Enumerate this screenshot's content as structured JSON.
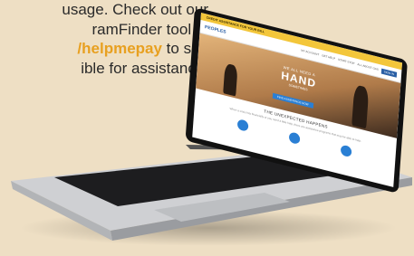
{
  "promo": {
    "line1": "usage. Check out our",
    "line2": "ramFinder tool at",
    "line3": "/helpmepay",
    "line3_suffix": " to see",
    "line4": "ible for assistance."
  },
  "screen": {
    "banner": "CREDIT ASSISTANCE FOR YOUR BILL",
    "logo": "PEOPLES",
    "nav": [
      "MY ACCOUNT",
      "GET HELP",
      "START STOP",
      "ALL ABOUT GAS"
    ],
    "nav_cta": "SIGN IN",
    "hero_small": "WE ALL NEED A",
    "hero_big": "HAND",
    "hero_sub": "SOMETIMES",
    "hero_button": "FIND ASSISTANCE NOW",
    "section_title": "THE UNEXPECTED HAPPENS",
    "section_text": "When a crisis hits financially or you need a little help, there are assistance programs that may be able to help."
  },
  "colors": {
    "background": "#eedfc4",
    "accent": "#e8a020",
    "screen_blue": "#2a7fd4",
    "banner_yellow": "#f3c63a"
  }
}
